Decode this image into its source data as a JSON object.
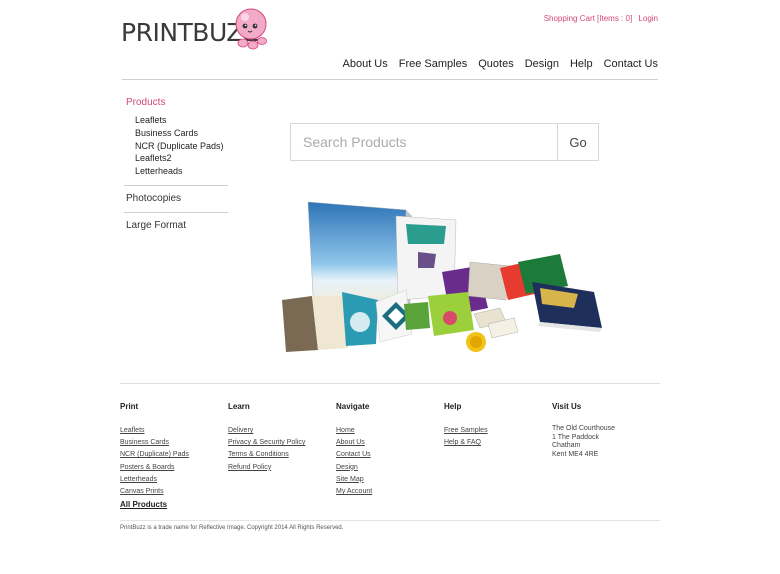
{
  "brand": {
    "logo_print": "PRINT",
    "logo_buzz": "BUZZ",
    "mascot_icon": "pink-mascot-icon",
    "accent": "#d4477a"
  },
  "topbar": {
    "cart": "Shopping Cart [Items : 0]",
    "login": "Login"
  },
  "nav": [
    "About Us",
    "Free Samples",
    "Quotes",
    "Design",
    "Help",
    "Contact Us"
  ],
  "sidebar": {
    "active_category": "Products",
    "subitems": [
      "Leaflets",
      "Business Cards",
      "NCR (Duplicate Pads)",
      "Leaflets2",
      "Letterheads"
    ],
    "categories": [
      "Photocopies",
      "Large Format"
    ]
  },
  "search": {
    "placeholder": "Search Products",
    "button": "Go"
  },
  "footer": {
    "columns": [
      {
        "heading": "Print",
        "links": [
          "Leaflets",
          "Business Cards",
          "NCR (Duplicate) Pads",
          "Posters & Boards",
          "Letterheads",
          "Canvas Prints"
        ],
        "bold_link": "All Products"
      },
      {
        "heading": "Learn",
        "links": [
          "Delivery",
          "Privacy & Security Policy",
          "Terms & Conditions",
          "Refund Policy"
        ]
      },
      {
        "heading": "Navigate",
        "links": [
          "Home",
          "About Us",
          "Contact Us",
          "Design",
          "Site Map",
          "My Account"
        ]
      },
      {
        "heading": "Help",
        "links": [
          "Free Samples",
          "Help & FAQ"
        ]
      },
      {
        "heading": "Visit Us",
        "address": [
          "The Old Courthouse",
          "1 The Paddock",
          "Chatham",
          "Kent ME4 4RE"
        ]
      }
    ],
    "copyright": "PrintBuzz is a trade name for Reflective Image. Copyright 2014 All Rights Reserved."
  }
}
